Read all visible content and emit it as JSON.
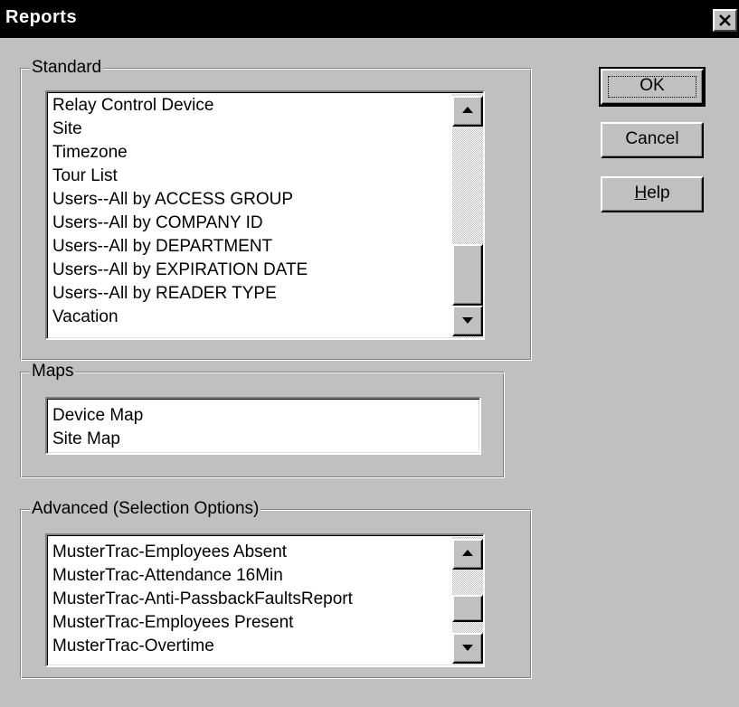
{
  "window": {
    "title": "Reports"
  },
  "buttons": {
    "ok": "OK",
    "cancel": "Cancel",
    "help_mnemonic": "H",
    "help_rest": "elp"
  },
  "standard": {
    "label": "Standard",
    "items": [
      "Relay Control Device",
      "Site",
      "Timezone",
      "Tour List",
      "Users--All by ACCESS GROUP",
      "Users--All by COMPANY ID",
      "Users--All by DEPARTMENT",
      "Users--All by EXPIRATION DATE",
      "Users--All by READER TYPE",
      "Vacation"
    ]
  },
  "maps": {
    "label": "Maps",
    "items": [
      "Device Map",
      "Site Map"
    ]
  },
  "advanced": {
    "label": "Advanced (Selection Options)",
    "items": [
      "MusterTrac-Employees Absent",
      "MusterTrac-Attendance 16Min",
      "MusterTrac-Anti-PassbackFaultsReport",
      "MusterTrac-Employees Present",
      "MusterTrac-Overtime"
    ]
  },
  "icons": {
    "close": "close-icon",
    "scroll_up": "arrow-up-icon",
    "scroll_down": "arrow-down-icon"
  }
}
